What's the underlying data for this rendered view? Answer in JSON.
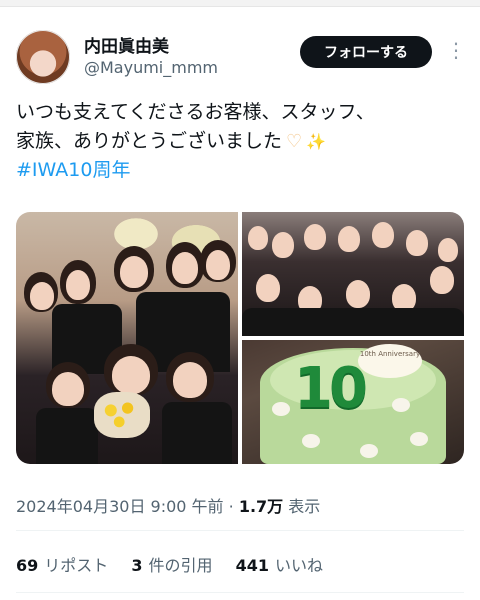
{
  "author": {
    "display_name": "内田眞由美",
    "handle": "@Mayumi_mmm",
    "follow_label": "フォローする"
  },
  "tweet": {
    "line1": "いつも支えてくださるお客様、スタッフ、",
    "line2": "家族、ありがとうございました",
    "hashtag": "#IWA10周年"
  },
  "media": {
    "cake_number": "10",
    "cake_plaque": "10th Anniversary"
  },
  "meta": {
    "timestamp": "2024年04月30日 9:00 午前",
    "separator": "·",
    "views_count": "1.7万",
    "views_label": "表示"
  },
  "stats": {
    "reposts_count": "69",
    "reposts_label": "リポスト",
    "quotes_count": "3",
    "quotes_label": "件の引用",
    "likes_count": "441",
    "likes_label": "いいね"
  },
  "icons": [
    "more-icon",
    "heart-hands-icon",
    "sparkles-icon"
  ],
  "colors": {
    "accent": "#1d9bf0",
    "text": "#0f1419",
    "muted": "#536471"
  }
}
